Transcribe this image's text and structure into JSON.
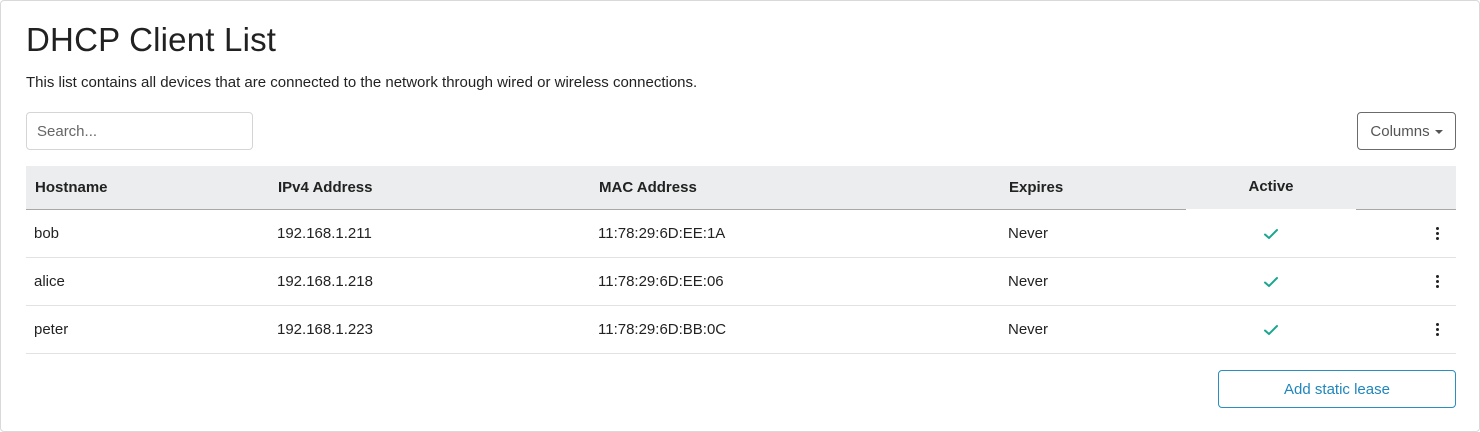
{
  "page": {
    "title": "DHCP Client List",
    "description": "This list contains all devices that are connected to the network through wired or wireless connections."
  },
  "toolbar": {
    "search_placeholder": "Search...",
    "columns_label": "Columns",
    "columns_icon": "caret-down-icon"
  },
  "table": {
    "headers": {
      "hostname": "Hostname",
      "ipv4": "IPv4 Address",
      "mac": "MAC Address",
      "expires": "Expires",
      "active": "Active"
    },
    "rows": [
      {
        "hostname": "bob",
        "ipv4": "192.168.1.211",
        "mac": "11:78:29:6D:EE:1A",
        "expires": "Never",
        "active": true
      },
      {
        "hostname": "alice",
        "ipv4": "192.168.1.218",
        "mac": "11:78:29:6D:EE:06",
        "expires": "Never",
        "active": true
      },
      {
        "hostname": "peter",
        "ipv4": "192.168.1.223",
        "mac": "11:78:29:6D:BB:0C",
        "expires": "Never",
        "active": true
      }
    ],
    "active_icon": "check-icon",
    "row_menu_icon": "kebab-menu-icon"
  },
  "actions": {
    "add_static_lease_label": "Add static lease"
  },
  "colors": {
    "check": "#1aa68f",
    "link_button": "#1f86bd",
    "header_bg": "#ebedee"
  }
}
